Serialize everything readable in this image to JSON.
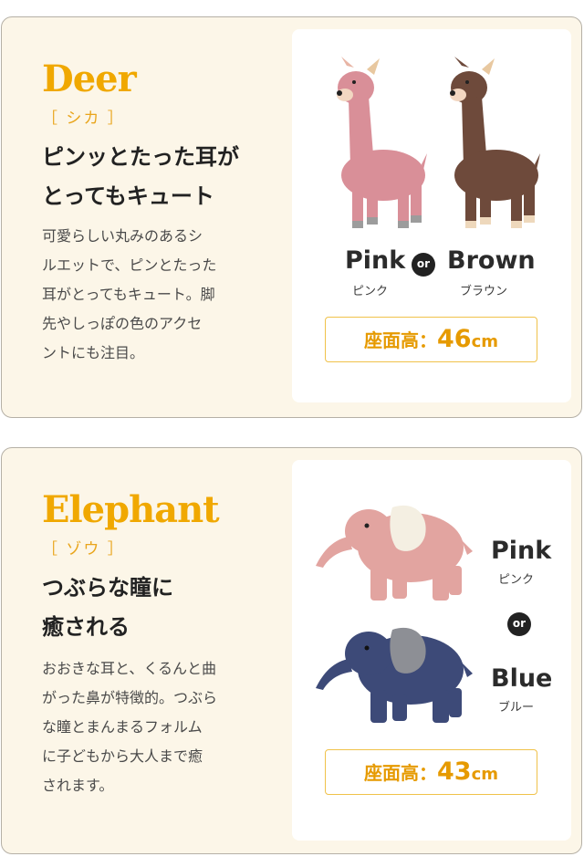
{
  "deer": {
    "title": "Deer",
    "kana": "［ シカ ］",
    "headline_line1": "ピンッとたった耳が",
    "headline_line2": "とってもキュート",
    "desc_lines": [
      "可愛らしい丸みのあるシ",
      "ルエットで、ピンとたった",
      "耳がとってもキュート。脚",
      "先やしっぽの色のアクセ",
      "ントにも注目。"
    ],
    "color1": "Pink",
    "color1_kana": "ピンク",
    "or": "or",
    "color2": "Brown",
    "color2_kana": "ブラウン",
    "seat_label": "座面高：",
    "seat_value": "46",
    "seat_unit": "cm",
    "colors": {
      "pink": "#d98f98",
      "brown": "#6e4a3b"
    }
  },
  "elephant": {
    "title": "Elephant",
    "kana": "［ ゾウ ］",
    "headline_line1": "つぶらな瞳に",
    "headline_line2": "癒される",
    "desc_lines": [
      "おおきな耳と、くるんと曲",
      "がった鼻が特徴的。つぶら",
      "な瞳とまんまるフォルム",
      "に子どもから大人まで癒",
      "されます。"
    ],
    "color1": "Pink",
    "color1_kana": "ピンク",
    "or": "or",
    "color2": "Blue",
    "color2_kana": "ブルー",
    "seat_label": "座面高：",
    "seat_value": "43",
    "seat_unit": "cm",
    "colors": {
      "pink": "#e2a4a0",
      "blue": "#3d4a78"
    }
  },
  "accent_color": "#f0a800"
}
